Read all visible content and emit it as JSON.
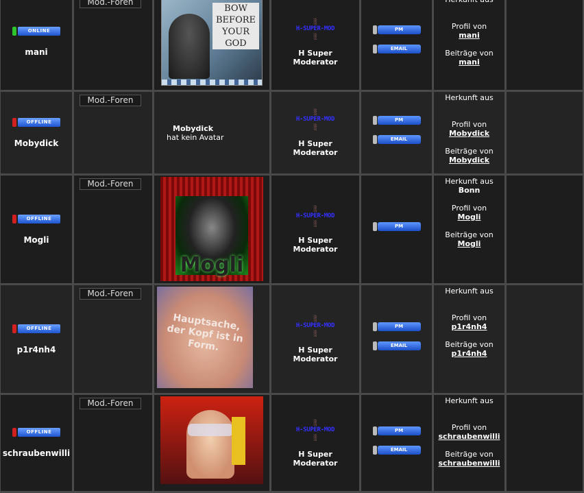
{
  "labels": {
    "mod_foren": "Mod.-Foren",
    "no_avatar": "hat kein Avatar",
    "herkunft": "Herkunft aus",
    "profil": "Profil von",
    "beitraege": "Beiträge von",
    "pm": "PM",
    "email": "EMAIL",
    "rank_image": "H-SUPER-MOD",
    "rank_name_1": "H Super",
    "rank_name_2": "Moderator"
  },
  "colors": {
    "online": "#2ec62e",
    "offline": "#d02020",
    "button": "#2a62dc"
  },
  "members": [
    {
      "name": "mani",
      "status": "ONLINE",
      "herkunft": "",
      "avatar_text": "BOW BEFORE YOUR GOD",
      "has_email": true
    },
    {
      "name": "Mobydick",
      "status": "OFFLINE",
      "herkunft": "",
      "avatar_text": "",
      "has_email": true
    },
    {
      "name": "Mogli",
      "status": "OFFLINE",
      "herkunft": "Bonn",
      "avatar_text": "Mogli",
      "has_email": false
    },
    {
      "name": "p1r4nh4",
      "status": "OFFLINE",
      "herkunft": "",
      "avatar_text": "Hauptsache, der Kopf ist in Form.",
      "has_email": true
    },
    {
      "name": "schraubenwilli",
      "status": "OFFLINE",
      "herkunft": "",
      "avatar_text": "",
      "has_email": true
    }
  ]
}
